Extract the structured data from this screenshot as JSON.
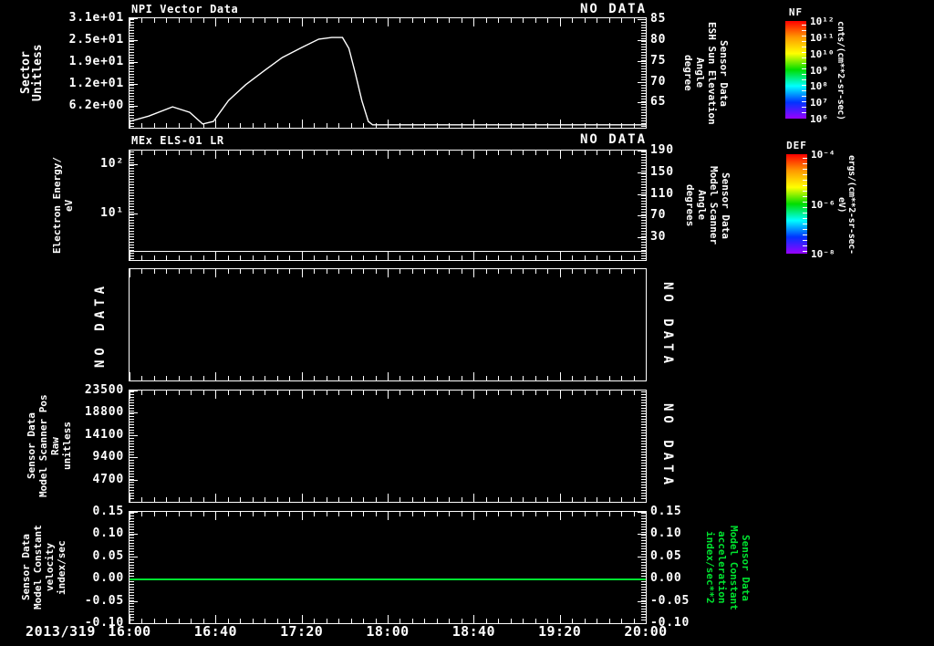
{
  "x_axis": {
    "date_label": "2013/319",
    "tick_labels": [
      "16:00",
      "16:40",
      "17:20",
      "18:00",
      "18:40",
      "19:20",
      "20:00"
    ]
  },
  "colors": {
    "foreground": "#ffffff",
    "background": "#000000",
    "accent_green": "#00e430",
    "rainbow": [
      "#ff0000",
      "#ff9900",
      "#ffff00",
      "#00dd00",
      "#00ffff",
      "#0033ff",
      "#9900ff"
    ]
  },
  "panels": [
    {
      "title": "NPI Vector Data",
      "status_label": "NO DATA",
      "left_axis": {
        "title_lines": [
          "Sector",
          "Unitless"
        ],
        "ticks": [
          {
            "label": "3.1e+01",
            "frac": 0.0
          },
          {
            "label": "2.5e+01",
            "frac": 0.2
          },
          {
            "label": "1.9e+01",
            "frac": 0.4
          },
          {
            "label": "1.2e+01",
            "frac": 0.6
          },
          {
            "label": "6.2e+00",
            "frac": 0.8
          }
        ]
      },
      "right_axis": {
        "title_lines": [
          "Sensor Data",
          "ESH Sun Elevation",
          "Angle",
          "degree"
        ],
        "ticks": [
          {
            "label": "85",
            "frac": 0.01
          },
          {
            "label": "80",
            "frac": 0.2
          },
          {
            "label": "75",
            "frac": 0.39
          },
          {
            "label": "70",
            "frac": 0.58
          },
          {
            "label": "65",
            "frac": 0.77
          }
        ]
      }
    },
    {
      "title": "MEx ELS-01 LR",
      "status_label": "NO DATA",
      "left_axis": {
        "title_lines": [
          "Electron Energy/",
          "eV"
        ],
        "ticks": [
          {
            "label": "10²",
            "frac": 0.125
          },
          {
            "label": "10¹",
            "frac": 0.575
          }
        ]
      },
      "right_axis": {
        "title_lines": [
          "Sensor Data",
          "Model Scanner",
          "Angle",
          "degrees"
        ],
        "ticks": [
          {
            "label": "190",
            "frac": 0.0
          },
          {
            "label": "150",
            "frac": 0.2
          },
          {
            "label": "110",
            "frac": 0.4
          },
          {
            "label": "70",
            "frac": 0.59
          },
          {
            "label": "30",
            "frac": 0.79
          }
        ]
      }
    },
    {
      "left_axis": {
        "no_data_label": "NO DATA",
        "ticks": []
      },
      "right_axis": {
        "no_data_label": "NO DATA",
        "ticks": []
      }
    },
    {
      "left_axis": {
        "title_lines": [
          "Sensor Data",
          "Model Scanner Pos",
          "Raw",
          "unitless"
        ],
        "ticks": [
          {
            "label": "23500",
            "frac": 0.0
          },
          {
            "label": "18800",
            "frac": 0.2
          },
          {
            "label": "14100",
            "frac": 0.4
          },
          {
            "label": "9400",
            "frac": 0.6
          },
          {
            "label": "4700",
            "frac": 0.8
          }
        ]
      },
      "right_axis": {
        "no_data_label": "NO DATA",
        "ticks": []
      }
    },
    {
      "left_axis": {
        "title_lines": [
          "Sensor Data",
          "Model Constant",
          "velocity",
          "index/sec"
        ],
        "ticks": [
          {
            "label": "0.15",
            "frac": 0.0
          },
          {
            "label": "0.10",
            "frac": 0.2
          },
          {
            "label": "0.05",
            "frac": 0.4
          },
          {
            "label": "0.00",
            "frac": 0.6
          },
          {
            "label": "-0.05",
            "frac": 0.8
          },
          {
            "label": "-0.10",
            "frac": 1.0
          }
        ]
      },
      "right_axis": {
        "title_lines": [
          "Sensor Data",
          "Model Constant",
          "acceleration",
          "index/sec**2"
        ],
        "title_green": true,
        "ticks": [
          {
            "label": "0.15",
            "frac": 0.0
          },
          {
            "label": "0.10",
            "frac": 0.2
          },
          {
            "label": "0.05",
            "frac": 0.4
          },
          {
            "label": "0.00",
            "frac": 0.6
          },
          {
            "label": "-0.05",
            "frac": 0.8
          },
          {
            "label": "-0.10",
            "frac": 1.0
          }
        ]
      }
    }
  ],
  "colorbars": [
    {
      "title": "NF",
      "unit": "cnts/(cm**2-sr-sec)",
      "tick_labels": [
        "10¹²",
        "10¹¹",
        "10¹⁰",
        "10⁹",
        "10⁸",
        "10⁷",
        "10⁶"
      ]
    },
    {
      "title": "DEF",
      "unit": "ergs/(cm**2-sr-sec-eV)",
      "tick_labels": [
        "10⁻⁴",
        "10⁻⁶",
        "10⁻⁸"
      ]
    }
  ],
  "chart_data": [
    {
      "type": "line",
      "title": "NPI Vector Data",
      "x_range": [
        "16:00",
        "20:00"
      ],
      "x_total_minutes": 240,
      "ylim_left": [
        0,
        31
      ],
      "ylim_right": [
        59.0,
        85.2
      ],
      "series": [
        {
          "name": "ESH Sun Elevation Angle",
          "units": "degree",
          "axis": "right",
          "x_minutes_after_start": [
            0,
            9,
            20,
            28,
            34,
            39,
            46,
            54,
            63,
            71,
            80,
            88,
            94,
            99,
            102,
            105,
            108,
            111,
            113,
            207,
            240
          ],
          "y_degrees": [
            60.5,
            61.8,
            64.0,
            62.7,
            59.9,
            60.5,
            65.5,
            69.3,
            72.8,
            75.8,
            78.2,
            80.2,
            80.6,
            80.6,
            78.0,
            72.0,
            65.5,
            60.5,
            59.7,
            59.7,
            59.7
          ]
        }
      ]
    },
    {
      "type": "line",
      "title": "MEx ELS-01 LR",
      "y_scale": "log",
      "ylim_eV": [
        1.15,
        190
      ],
      "series": [
        {
          "name": "Electron Energy baseline",
          "units": "eV",
          "y_constant": 1.8,
          "frac_from_top": 0.915
        }
      ]
    },
    {
      "type": "none",
      "title": "NO DATA"
    },
    {
      "type": "none",
      "title": "Sensor Data Model Scanner Pos Raw",
      "ylim": [
        0,
        23500
      ]
    },
    {
      "type": "line",
      "title": "Sensor Data Model Constant velocity / acceleration",
      "ylim": [
        -0.1,
        0.15
      ],
      "series": [
        {
          "name": "Model Constant acceleration",
          "units": "index/sec**2",
          "y_constant": 0.0,
          "color": "#00e430"
        }
      ]
    }
  ]
}
